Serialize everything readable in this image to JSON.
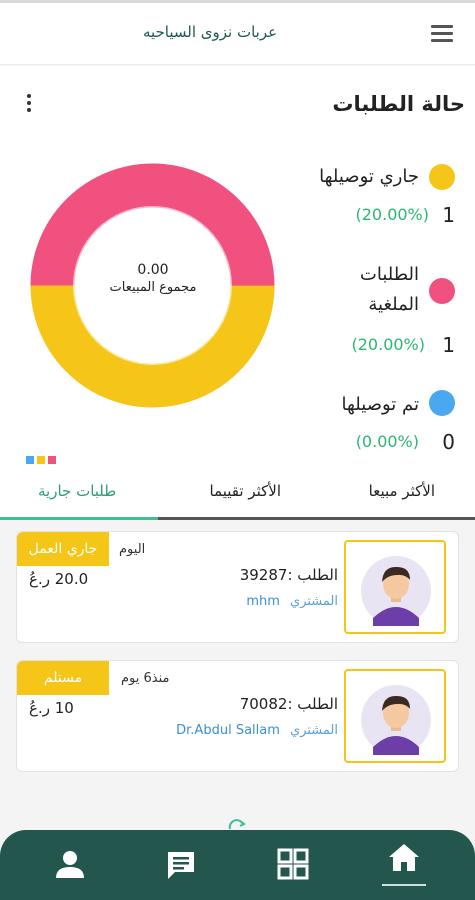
{
  "app": {
    "title": "عربات نزوى السياحيه"
  },
  "status": {
    "title": "حالة الطلبات",
    "donut": {
      "total_value": "0.00",
      "total_label": "مجموع المبيعات"
    },
    "legend": [
      {
        "label": "جاري توصيلها",
        "count": "1",
        "percent": "(20.00%)",
        "color": "#f5c518"
      },
      {
        "label": "الطلبات الملغية",
        "count": "1",
        "percent": "(20.00%)",
        "color": "#f0517f"
      },
      {
        "label": "تم توصيلها",
        "count": "0",
        "percent": "(0.00%)",
        "color": "#4aa8f0"
      }
    ]
  },
  "tabs": [
    {
      "label": "الأكثر مبيعا"
    },
    {
      "label": "الأكثر تقييما"
    },
    {
      "label": "طلبات جارية"
    }
  ],
  "orders": [
    {
      "order_label": "الطلب :39287",
      "buyer_label": "المشتري",
      "buyer_name": "mhm",
      "time": "اليوم",
      "status": "جاري العمل",
      "price": "20.0 ر.عُ"
    },
    {
      "order_label": "الطلب :70082",
      "buyer_label": "المشتري",
      "buyer_name": "Dr.Abdul Sallam",
      "time": "منذ6 يوم",
      "status": "مستلم",
      "price": "10 ر.عُ"
    }
  ],
  "colors": {
    "accent": "#23564c",
    "yellow": "#f5c518",
    "pink": "#f0517f",
    "blue": "#4aa8f0",
    "green": "#2bb673"
  },
  "bottom_nav": [
    "profile-icon",
    "chat-icon",
    "grid-icon",
    "home-icon"
  ]
}
